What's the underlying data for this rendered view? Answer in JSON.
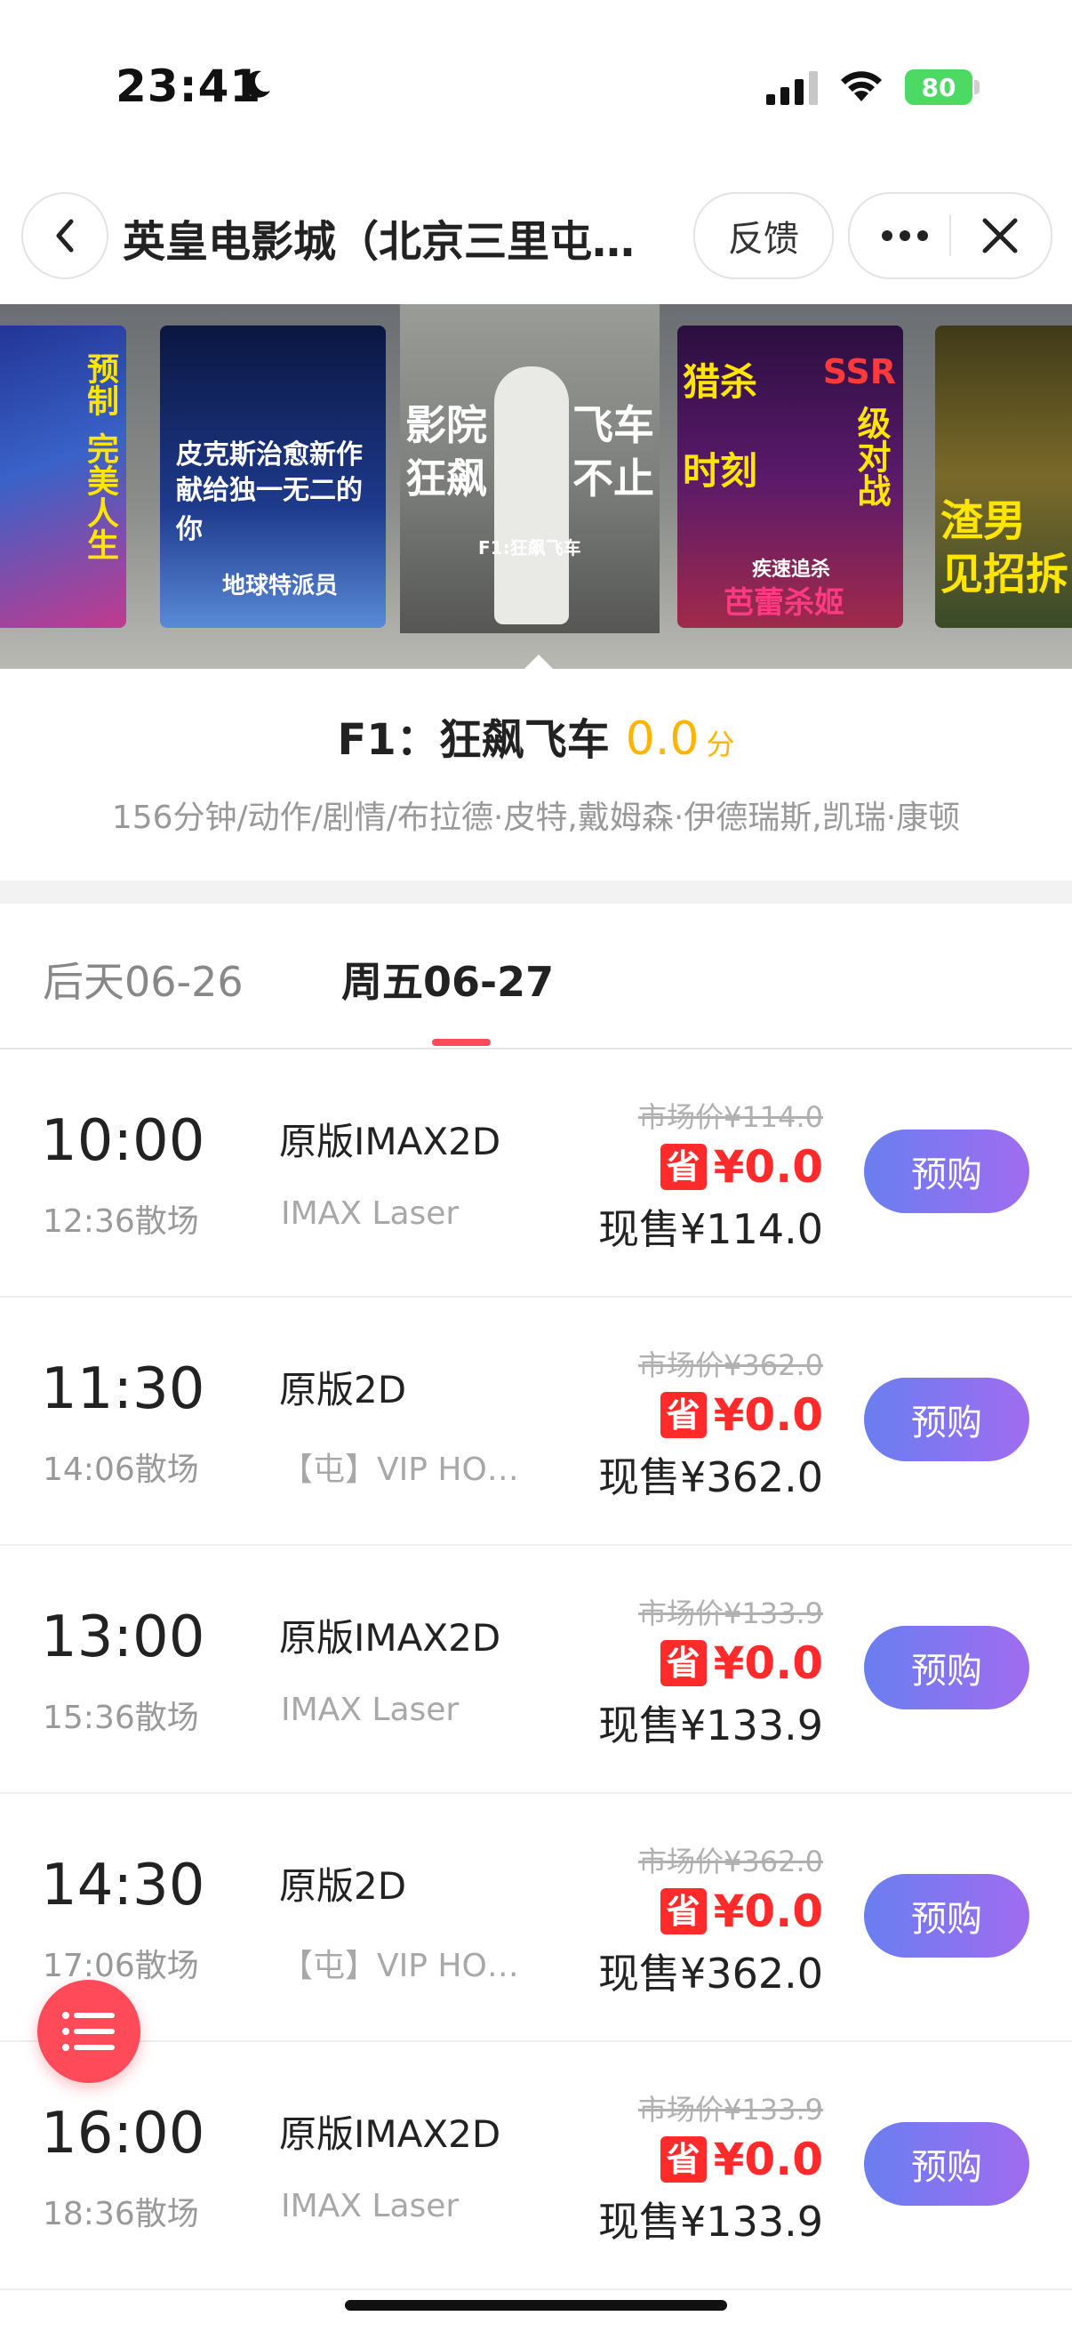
{
  "status": {
    "time": "23:41",
    "battery": "80"
  },
  "nav": {
    "title": "英皇电影城（北京三里屯…",
    "feedback": "反馈"
  },
  "posters": [
    {
      "lines": [
        "预制",
        "完美人生"
      ],
      "color": "#ffe500"
    },
    {
      "lines": [
        "皮克斯治愈新作",
        "献给独一无二的你",
        "地球特派员"
      ],
      "color": "#ffffff"
    },
    {
      "lines": [
        "影院",
        "狂飙",
        "飞车",
        "不止",
        "F1:狂飙飞车"
      ],
      "color": "#ffffff"
    },
    {
      "lines": [
        "猎杀",
        "时刻",
        "SSR",
        "级对战",
        "疾速追杀",
        "芭蕾杀姬"
      ],
      "color": "#ffe500"
    },
    {
      "lines": [
        "渣男",
        "见招拆"
      ],
      "color": "#ffe500"
    }
  ],
  "movie": {
    "name": "F1：狂飙飞车",
    "score": "0.0",
    "score_unit": "分",
    "meta": "156分钟/动作/剧情/布拉德·皮特,戴姆森·伊德瑞斯,凯瑞·康顿"
  },
  "tabs": [
    "后天06-26",
    "周五06-27"
  ],
  "shows": [
    {
      "start": "10:00",
      "end": "12:36散场",
      "version": "原版IMAX2D",
      "hall": "IMAX Laser",
      "market": "市场价¥114.0",
      "save_badge": "省",
      "save": "¥0.0",
      "now": "现售¥114.0",
      "btn": "预购"
    },
    {
      "start": "11:30",
      "end": "14:06散场",
      "version": "原版2D",
      "hall": "【屯】VIP HO…",
      "market": "市场价¥362.0",
      "save_badge": "省",
      "save": "¥0.0",
      "now": "现售¥362.0",
      "btn": "预购"
    },
    {
      "start": "13:00",
      "end": "15:36散场",
      "version": "原版IMAX2D",
      "hall": "IMAX Laser",
      "market": "市场价¥133.9",
      "save_badge": "省",
      "save": "¥0.0",
      "now": "现售¥133.9",
      "btn": "预购"
    },
    {
      "start": "14:30",
      "end": "17:06散场",
      "version": "原版2D",
      "hall": "【屯】VIP HO…",
      "market": "市场价¥362.0",
      "save_badge": "省",
      "save": "¥0.0",
      "now": "现售¥362.0",
      "btn": "预购"
    },
    {
      "start": "16:00",
      "end": "18:36散场",
      "version": "原版IMAX2D",
      "hall": "IMAX Laser",
      "market": "市场价¥133.9",
      "save_badge": "省",
      "save": "¥0.0",
      "now": "现售¥133.9",
      "btn": "预购"
    }
  ],
  "colors": {
    "accent": "#ff4a5a",
    "price_red": "#ff2b2b",
    "score": "#ffb400",
    "button_start": "#6a7ef0",
    "button_end": "#a06cf0"
  },
  "icons": [
    "moon-icon",
    "signal-icon",
    "wifi-icon",
    "battery-icon",
    "back-chevron-icon",
    "more-dots-icon",
    "close-icon",
    "list-menu-icon"
  ]
}
